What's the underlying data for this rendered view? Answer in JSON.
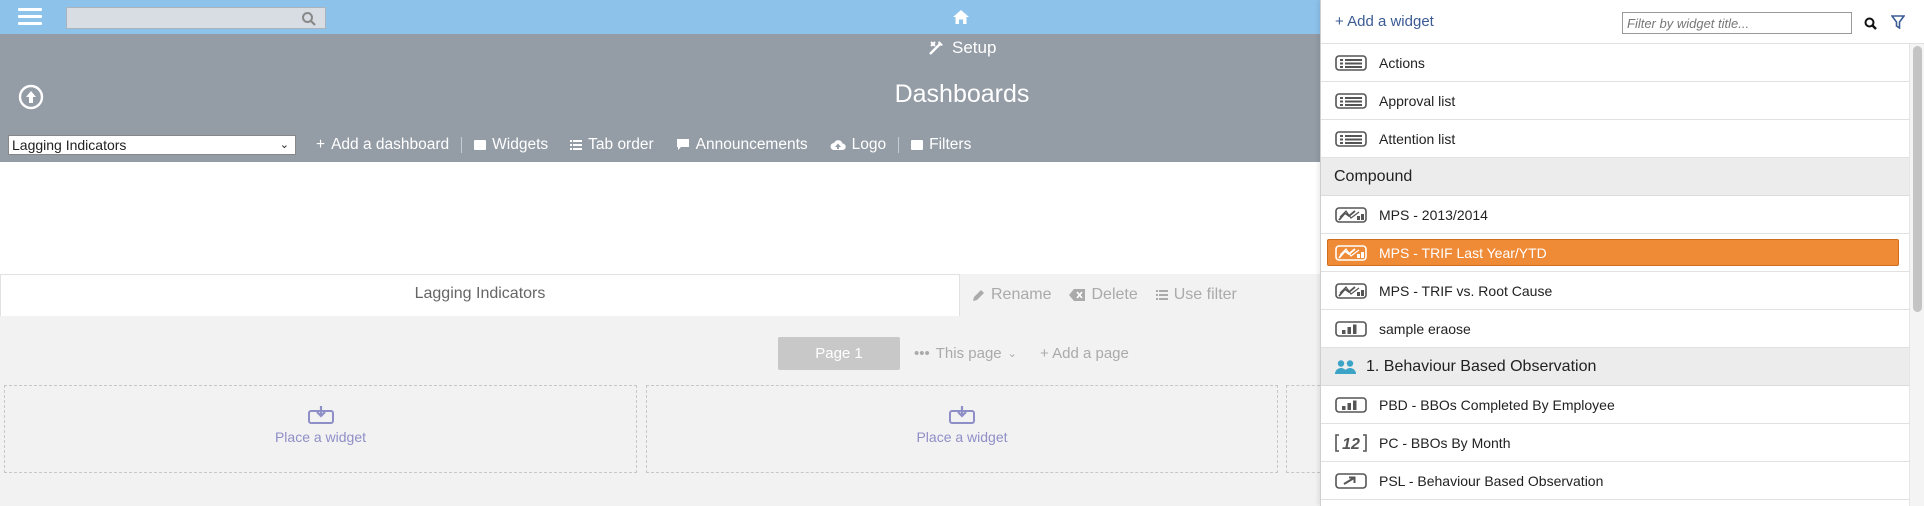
{
  "topbar": {
    "search_placeholder": "",
    "icons": [
      "hamburger-icon",
      "search-icon",
      "home-icon"
    ]
  },
  "header": {
    "setup_label": "Setup",
    "title": "Dashboards",
    "selected_dashboard": "Lagging Indicators",
    "toolbar": {
      "add_dashboard": "Add a dashboard",
      "widgets": "Widgets",
      "tab_order": "Tab order",
      "announcements": "Announcements",
      "logo": "Logo",
      "filters": "Filters"
    }
  },
  "tab": {
    "label": "Lagging Indicators",
    "rename": "Rename",
    "delete": "Delete",
    "use_filter": "Use filter"
  },
  "pages": {
    "current": "Page 1",
    "this_page": "This page",
    "add_page": "Add a page"
  },
  "placeholders": [
    "Place a widget",
    "Place a widget",
    "Place a widget"
  ],
  "panel": {
    "add_widget": "Add a widget",
    "filter_placeholder": "Filter by widget title...",
    "items": [
      {
        "type": "row",
        "icon": "list-icon",
        "label": "Actions"
      },
      {
        "type": "row",
        "icon": "list-icon",
        "label": "Approval list"
      },
      {
        "type": "row",
        "icon": "list-icon",
        "label": "Attention list"
      },
      {
        "type": "group",
        "label": "Compound"
      },
      {
        "type": "row",
        "icon": "compound-chart-icon",
        "label": "MPS - 2013/2014"
      },
      {
        "type": "row",
        "icon": "compound-chart-icon",
        "label": "MPS - TRIF Last Year/YTD",
        "selected": true
      },
      {
        "type": "row",
        "icon": "compound-chart-icon",
        "label": "MPS - TRIF vs. Root Cause"
      },
      {
        "type": "row",
        "icon": "bar-chart-icon",
        "label": "sample eraose"
      },
      {
        "type": "group",
        "icon": "people-icon",
        "label": "1. Behaviour Based Observation"
      },
      {
        "type": "row",
        "icon": "bar-chart-icon",
        "label": "PBD - BBOs Completed By Employee"
      },
      {
        "type": "row",
        "icon": "number-icon",
        "label": "PC - BBOs By Month"
      },
      {
        "type": "row",
        "icon": "arrow-box-icon",
        "label": "PSL - Behaviour Based Observation"
      }
    ]
  },
  "colors": {
    "topbar": "#8dc2ea",
    "header": "#949ca6",
    "selection": "#ef8a37",
    "link": "#3b5b95"
  }
}
